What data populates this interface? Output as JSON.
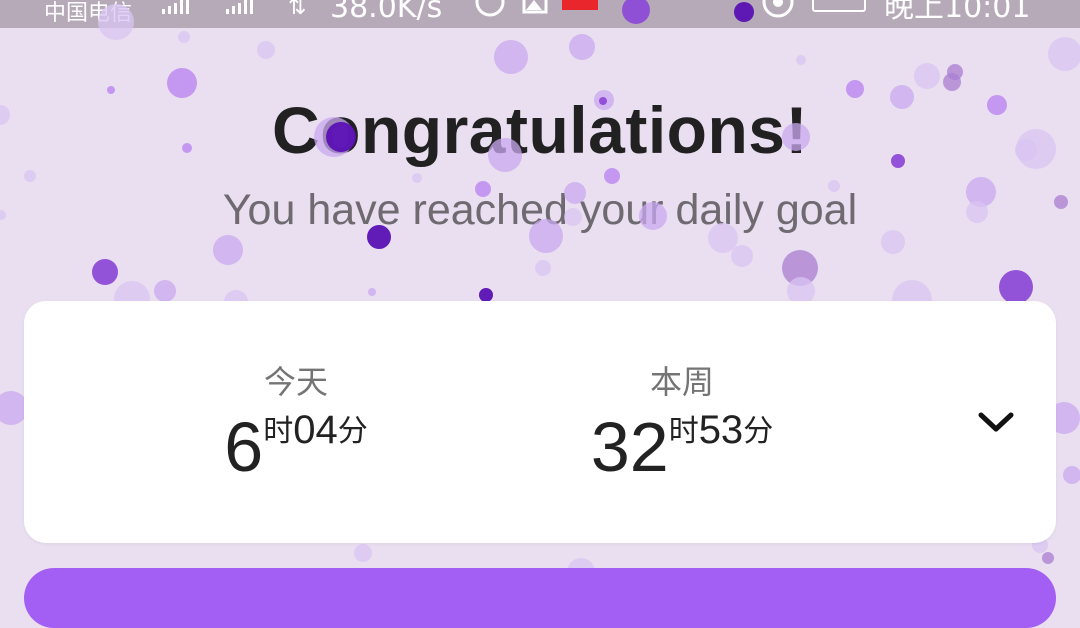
{
  "status_bar": {
    "carrier": "中国电信",
    "net_speed": "38.0K/s",
    "clock": "晚上10:01"
  },
  "heading": "Congratulations!",
  "subheading": "You have reached your daily goal",
  "stats": {
    "today": {
      "label": "今天",
      "hours": "6",
      "hours_unit": "时",
      "minutes": "04",
      "minutes_unit": "分"
    },
    "week": {
      "label": "本周",
      "hours": "32",
      "hours_unit": "时",
      "minutes": "53",
      "minutes_unit": "分"
    }
  },
  "icons": {
    "expand": "chevron-down-icon"
  },
  "colors": {
    "background": "#e9dff0",
    "accent": "#a35ff3",
    "confetti": [
      "#c9a8f0",
      "#b77ff0",
      "#8e4bd6",
      "#5a10b3",
      "#d9c4f3",
      "#a97ed2"
    ]
  }
}
